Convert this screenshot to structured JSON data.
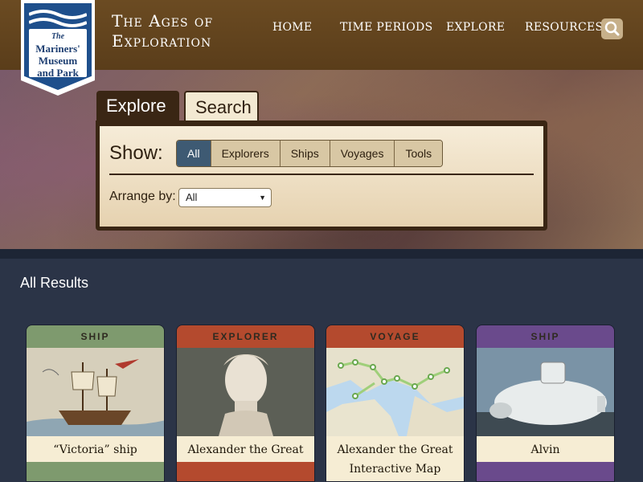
{
  "logo": {
    "line1": "The",
    "line2": "Mariners'",
    "line3": "Museum",
    "line4": "and Park"
  },
  "site_title": {
    "line1": "The Ages of",
    "line2": "Exploration"
  },
  "nav": [
    "HOME",
    "TIME PERIODS",
    "EXPLORE",
    "RESOURCES"
  ],
  "tabs": [
    "Explore",
    "Search"
  ],
  "show": {
    "label": "Show:",
    "filters": [
      "All",
      "Explorers",
      "Ships",
      "Voyages",
      "Tools"
    ],
    "active": "All"
  },
  "arrange": {
    "label": "Arrange by:",
    "selected": "All"
  },
  "results_title": "All Results",
  "cards": [
    {
      "type": "SHIP",
      "title": "“Victoria” ship",
      "color": "#7e9a6e"
    },
    {
      "type": "EXPLORER",
      "title": "Alexander the Great",
      "color": "#b44a2e"
    },
    {
      "type": "VOYAGE",
      "title": "Alexander the Great Interactive Map",
      "color": "#b44a2e"
    },
    {
      "type": "SHIP",
      "title": "Alvin",
      "color": "#6a4a8c"
    }
  ]
}
